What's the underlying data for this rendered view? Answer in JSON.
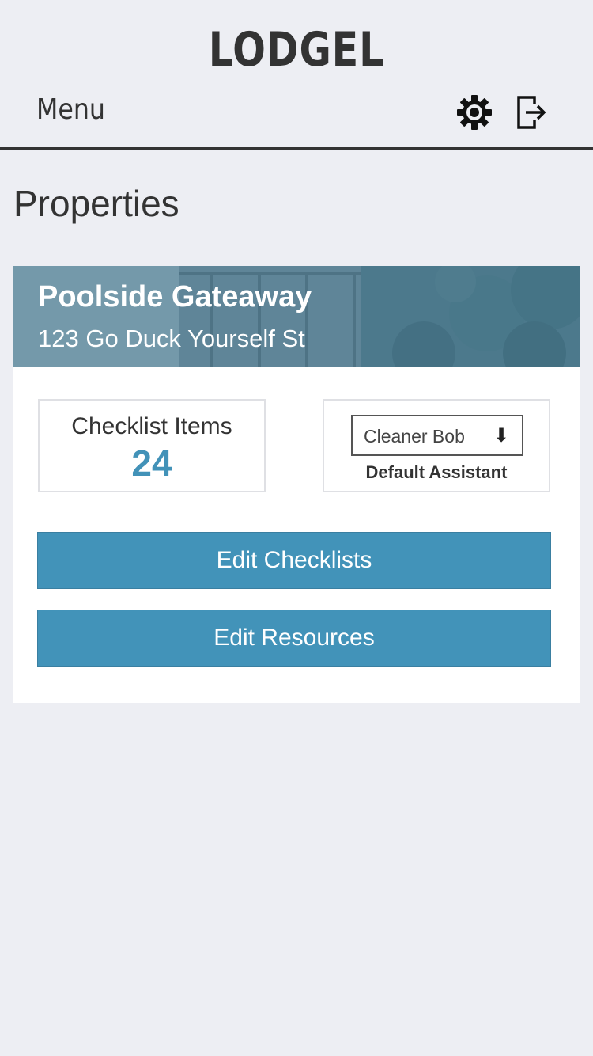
{
  "header": {
    "logo": "LODGEL",
    "menu_label": "Menu",
    "icons": [
      "gear-icon",
      "logout-icon"
    ]
  },
  "page": {
    "title": "Properties"
  },
  "property": {
    "name": "Poolside Gateaway",
    "address": "123 Go Duck Yourself St",
    "checklist_items_label": "Checklist Items",
    "checklist_items_count": "24",
    "assistant_select_value": "Cleaner Bob",
    "assistant_select_arrow": "⬇",
    "assistant_label": "Default Assistant",
    "edit_checklists_label": "Edit Checklists",
    "edit_resources_label": "Edit Resources"
  },
  "colors": {
    "background": "#edeef3",
    "text": "#333333",
    "accent": "#4293b9",
    "count": "#4292b8"
  }
}
